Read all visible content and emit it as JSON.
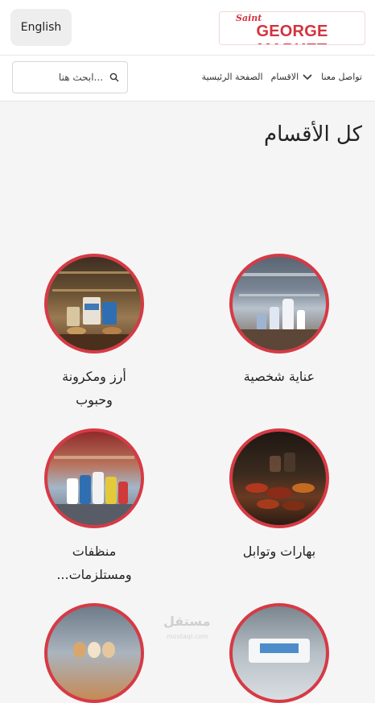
{
  "header": {
    "language_button": "English",
    "logo": {
      "top": "Saint",
      "main": "GEORGE MARKET"
    }
  },
  "nav": {
    "items": [
      "الصفحة الرئيسية",
      "الاقسام",
      "تواصل معنا"
    ]
  },
  "search": {
    "placeholder": "...ابحث هنا"
  },
  "main": {
    "title": "كل الأقسام",
    "categories": [
      {
        "name": "عناية شخصية",
        "image": "personal-care-photo"
      },
      {
        "name": "أرز ومكرونة وحبوب",
        "image": "rice-pasta-photo"
      },
      {
        "name": "بهارات وتوابل",
        "image": "spices-photo"
      },
      {
        "name": "منظفات ومستلزمات...",
        "image": "cleaners-photo"
      },
      {
        "name": "",
        "image": "dairy-photo"
      },
      {
        "name": "",
        "image": "eggs-photo"
      }
    ]
  },
  "watermark": {
    "main": "مستقل",
    "sub": "mostaql.com"
  },
  "colors": {
    "accent": "#d63a45",
    "logo": "#d2333f"
  }
}
